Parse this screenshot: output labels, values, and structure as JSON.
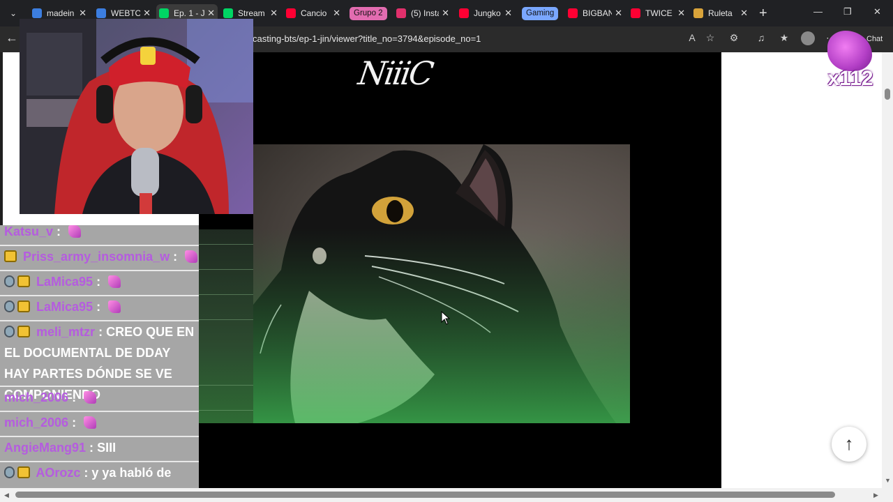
{
  "browser": {
    "tabs": [
      {
        "title": "madein",
        "color": "#3c7ee0"
      },
      {
        "title": "WEBTO",
        "color": "#00d564"
      },
      {
        "title": "Ep. 1 - J",
        "color": "#00d564",
        "active": true
      },
      {
        "title": "Stream",
        "color": "#00d564"
      },
      {
        "title": "Cancio",
        "color": "#ff0033"
      },
      {
        "title": "(5) Insta",
        "color": "#e1306c"
      },
      {
        "title": "Jungko",
        "color": "#ff0033"
      },
      {
        "title": "BIGBAN",
        "color": "#ff0033"
      },
      {
        "title": "TWICE",
        "color": "#ff0033"
      },
      {
        "title": "Ruleta",
        "color": "#d9a33a"
      }
    ],
    "groups": [
      {
        "label": "Grupo 2",
        "color": "#e26cb0"
      },
      {
        "label": "Gaming",
        "color": "#7aa7ff"
      }
    ],
    "url": "casting-bts/ep-1-jin/viewer?title_no=3794&episode_no=1",
    "chat_label": "Chat"
  },
  "page": {
    "scribble": "NiiiC"
  },
  "reward": {
    "count": "x112"
  },
  "chat": {
    "messages": [
      {
        "user": "Katsu_v",
        "sep": ":",
        "text": "",
        "emote": true,
        "badges": []
      },
      {
        "user": "Priss_army_insomnia_w",
        "sep": ":",
        "text": "",
        "emote": true,
        "badges": [
          "crown"
        ]
      },
      {
        "user": "LaMica95",
        "sep": ":",
        "text": "",
        "emote": true,
        "badges": [
          "mod",
          "crown"
        ]
      },
      {
        "user": "LaMica95",
        "sep": ":",
        "text": "",
        "emote": true,
        "badges": [
          "mod",
          "crown"
        ]
      },
      {
        "user": "meli_mtzr",
        "sep": ":",
        "text": "CREO QUE EN EL DOCUMENTAL DE DDAY HAY PARTES DÓNDE SE VE COMPONIENDO",
        "emote": false,
        "badges": [
          "mod",
          "crown"
        ]
      },
      {
        "user": "mich_2006",
        "sep": ":",
        "text": "",
        "emote": true,
        "badges": []
      },
      {
        "user": "mich_2006",
        "sep": ":",
        "text": "",
        "emote": true,
        "badges": []
      },
      {
        "user": "AngieMang91",
        "sep": ":",
        "text": "SIII",
        "emote": false,
        "badges": []
      },
      {
        "user": "AOrozc",
        "sep": ":",
        "text": "y ya habló de ellos",
        "emote": false,
        "badges": [
          "mod",
          "crown"
        ]
      }
    ]
  }
}
